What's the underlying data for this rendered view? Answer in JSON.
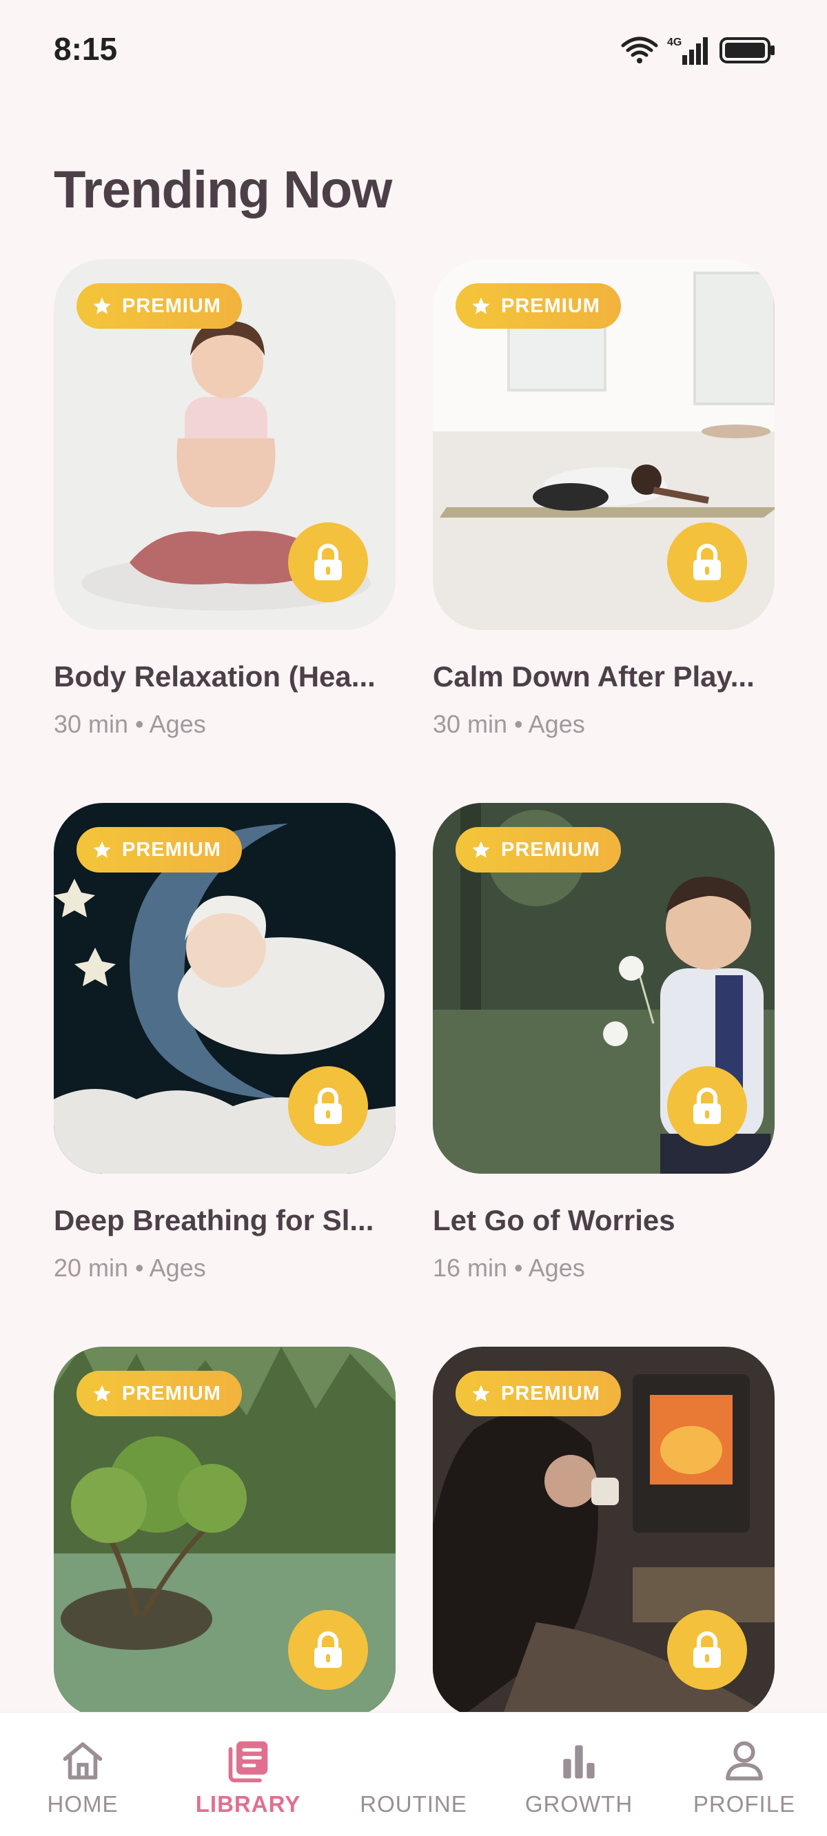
{
  "status": {
    "time": "8:15",
    "network": "4G"
  },
  "page": {
    "title": "Trending Now"
  },
  "badge_label": "PREMIUM",
  "cards": [
    {
      "title": "Body Relaxation (Hea...",
      "meta": "30 min • Ages"
    },
    {
      "title": "Calm Down After Play...",
      "meta": "30 min • Ages"
    },
    {
      "title": "Deep Breathing for Sl...",
      "meta": "20 min • Ages"
    },
    {
      "title": "Let Go of Worries",
      "meta": "16 min • Ages"
    },
    {
      "title": "",
      "meta": ""
    },
    {
      "title": "",
      "meta": ""
    }
  ],
  "nav": {
    "items": [
      {
        "label": "HOME",
        "icon": "home-icon"
      },
      {
        "label": "LIBRARY",
        "icon": "library-icon"
      },
      {
        "label": "ROUTINE",
        "icon": "moon-icon"
      },
      {
        "label": "GROWTH",
        "icon": "bar-chart-icon"
      },
      {
        "label": "PROFILE",
        "icon": "person-icon"
      }
    ],
    "active": "LIBRARY"
  },
  "colors": {
    "accent": "#e0708f",
    "premium": "#f3c13c",
    "background": "#fbf5f5",
    "title": "#4d3f48"
  }
}
